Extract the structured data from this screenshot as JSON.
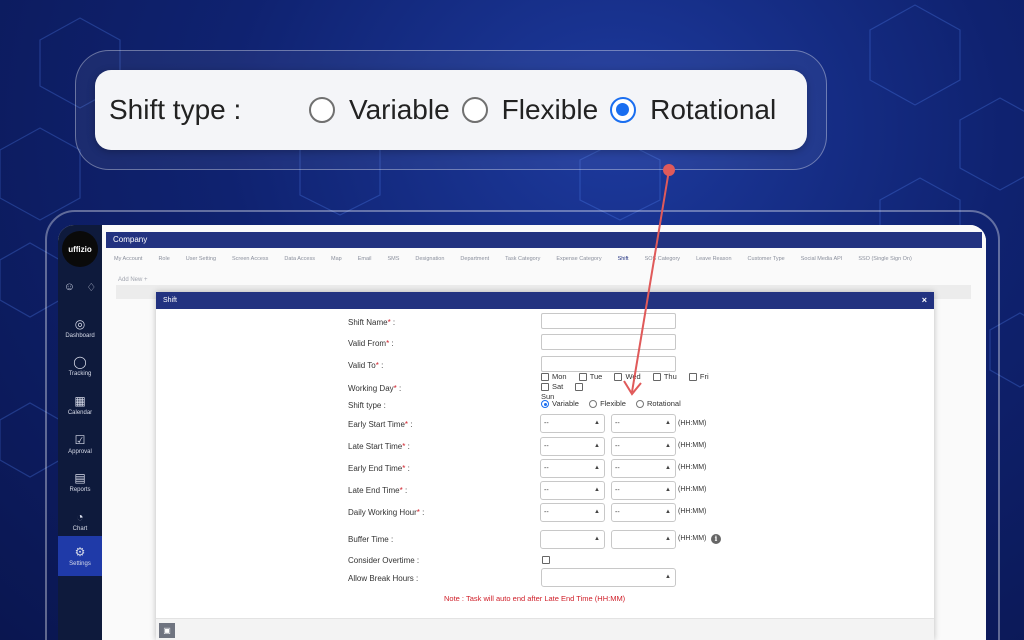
{
  "callout": {
    "label": "Shift type :",
    "options": [
      {
        "label": "Variable",
        "selected": false
      },
      {
        "label": "Flexible",
        "selected": false
      },
      {
        "label": "Rotational",
        "selected": true
      }
    ]
  },
  "logo": "uffizio",
  "sidebar": {
    "top_icons": [
      "user-icon",
      "bell-icon"
    ],
    "items": [
      {
        "label": "Dashboard",
        "icon": "gauge-icon",
        "active": false
      },
      {
        "label": "Tracking",
        "icon": "pin-icon",
        "active": false
      },
      {
        "label": "Calendar",
        "icon": "calendar-icon",
        "active": false
      },
      {
        "label": "Approval",
        "icon": "approval-icon",
        "active": false
      },
      {
        "label": "Reports",
        "icon": "report-icon",
        "active": false
      },
      {
        "label": "Chart",
        "icon": "chart-icon",
        "active": false
      },
      {
        "label": "Settings",
        "icon": "gear-icon",
        "active": true
      }
    ]
  },
  "header": {
    "title": "Company"
  },
  "tabs": [
    "My Account",
    "Role",
    "User Setting",
    "Screen Access",
    "Data Access",
    "Map",
    "Email",
    "SMS",
    "Designation",
    "Department",
    "Task Category",
    "Expense Category",
    "Shift",
    "SOS Category",
    "Leave Reason",
    "Customer Type",
    "Social Media API",
    "SSO (Single Sign On)"
  ],
  "selected_tab": "Shift",
  "add_new": "Add New",
  "modal": {
    "title": "Shift",
    "close": "×",
    "fields": {
      "shift_name": "Shift Name",
      "valid_from": "Valid From",
      "valid_to": "Valid To",
      "working_day": "Working Day",
      "shift_type": "Shift type :",
      "early_start": "Early Start Time",
      "late_start": "Late Start Time",
      "early_end": "Early End Time",
      "late_end": "Late End Time",
      "daily_hours": "Daily Working Hour",
      "buffer_time": "Buffer Time :",
      "overtime": "Consider Overtime :",
      "break_hours": "Allow Break Hours :"
    },
    "required_mark": "*",
    "colon": " :",
    "days": [
      "Mon",
      "Tue",
      "Wed",
      "Thu",
      "Fri",
      "Sat",
      "Sun"
    ],
    "shift_options": [
      {
        "label": "Variable",
        "selected": true
      },
      {
        "label": "Flexible",
        "selected": false
      },
      {
        "label": "Rotational",
        "selected": false
      }
    ],
    "select_placeholder": "--",
    "unit": "(HH:MM)",
    "info": "i",
    "note": "Note : Task will auto end after Late End Time (HH:MM)",
    "save_icon": "save-icon"
  },
  "colors": {
    "primary": "#223280",
    "sidebar": "#0e1a3c",
    "accent": "#1a6ef0",
    "required": "#d0202a",
    "arrow": "#e05a5a"
  }
}
